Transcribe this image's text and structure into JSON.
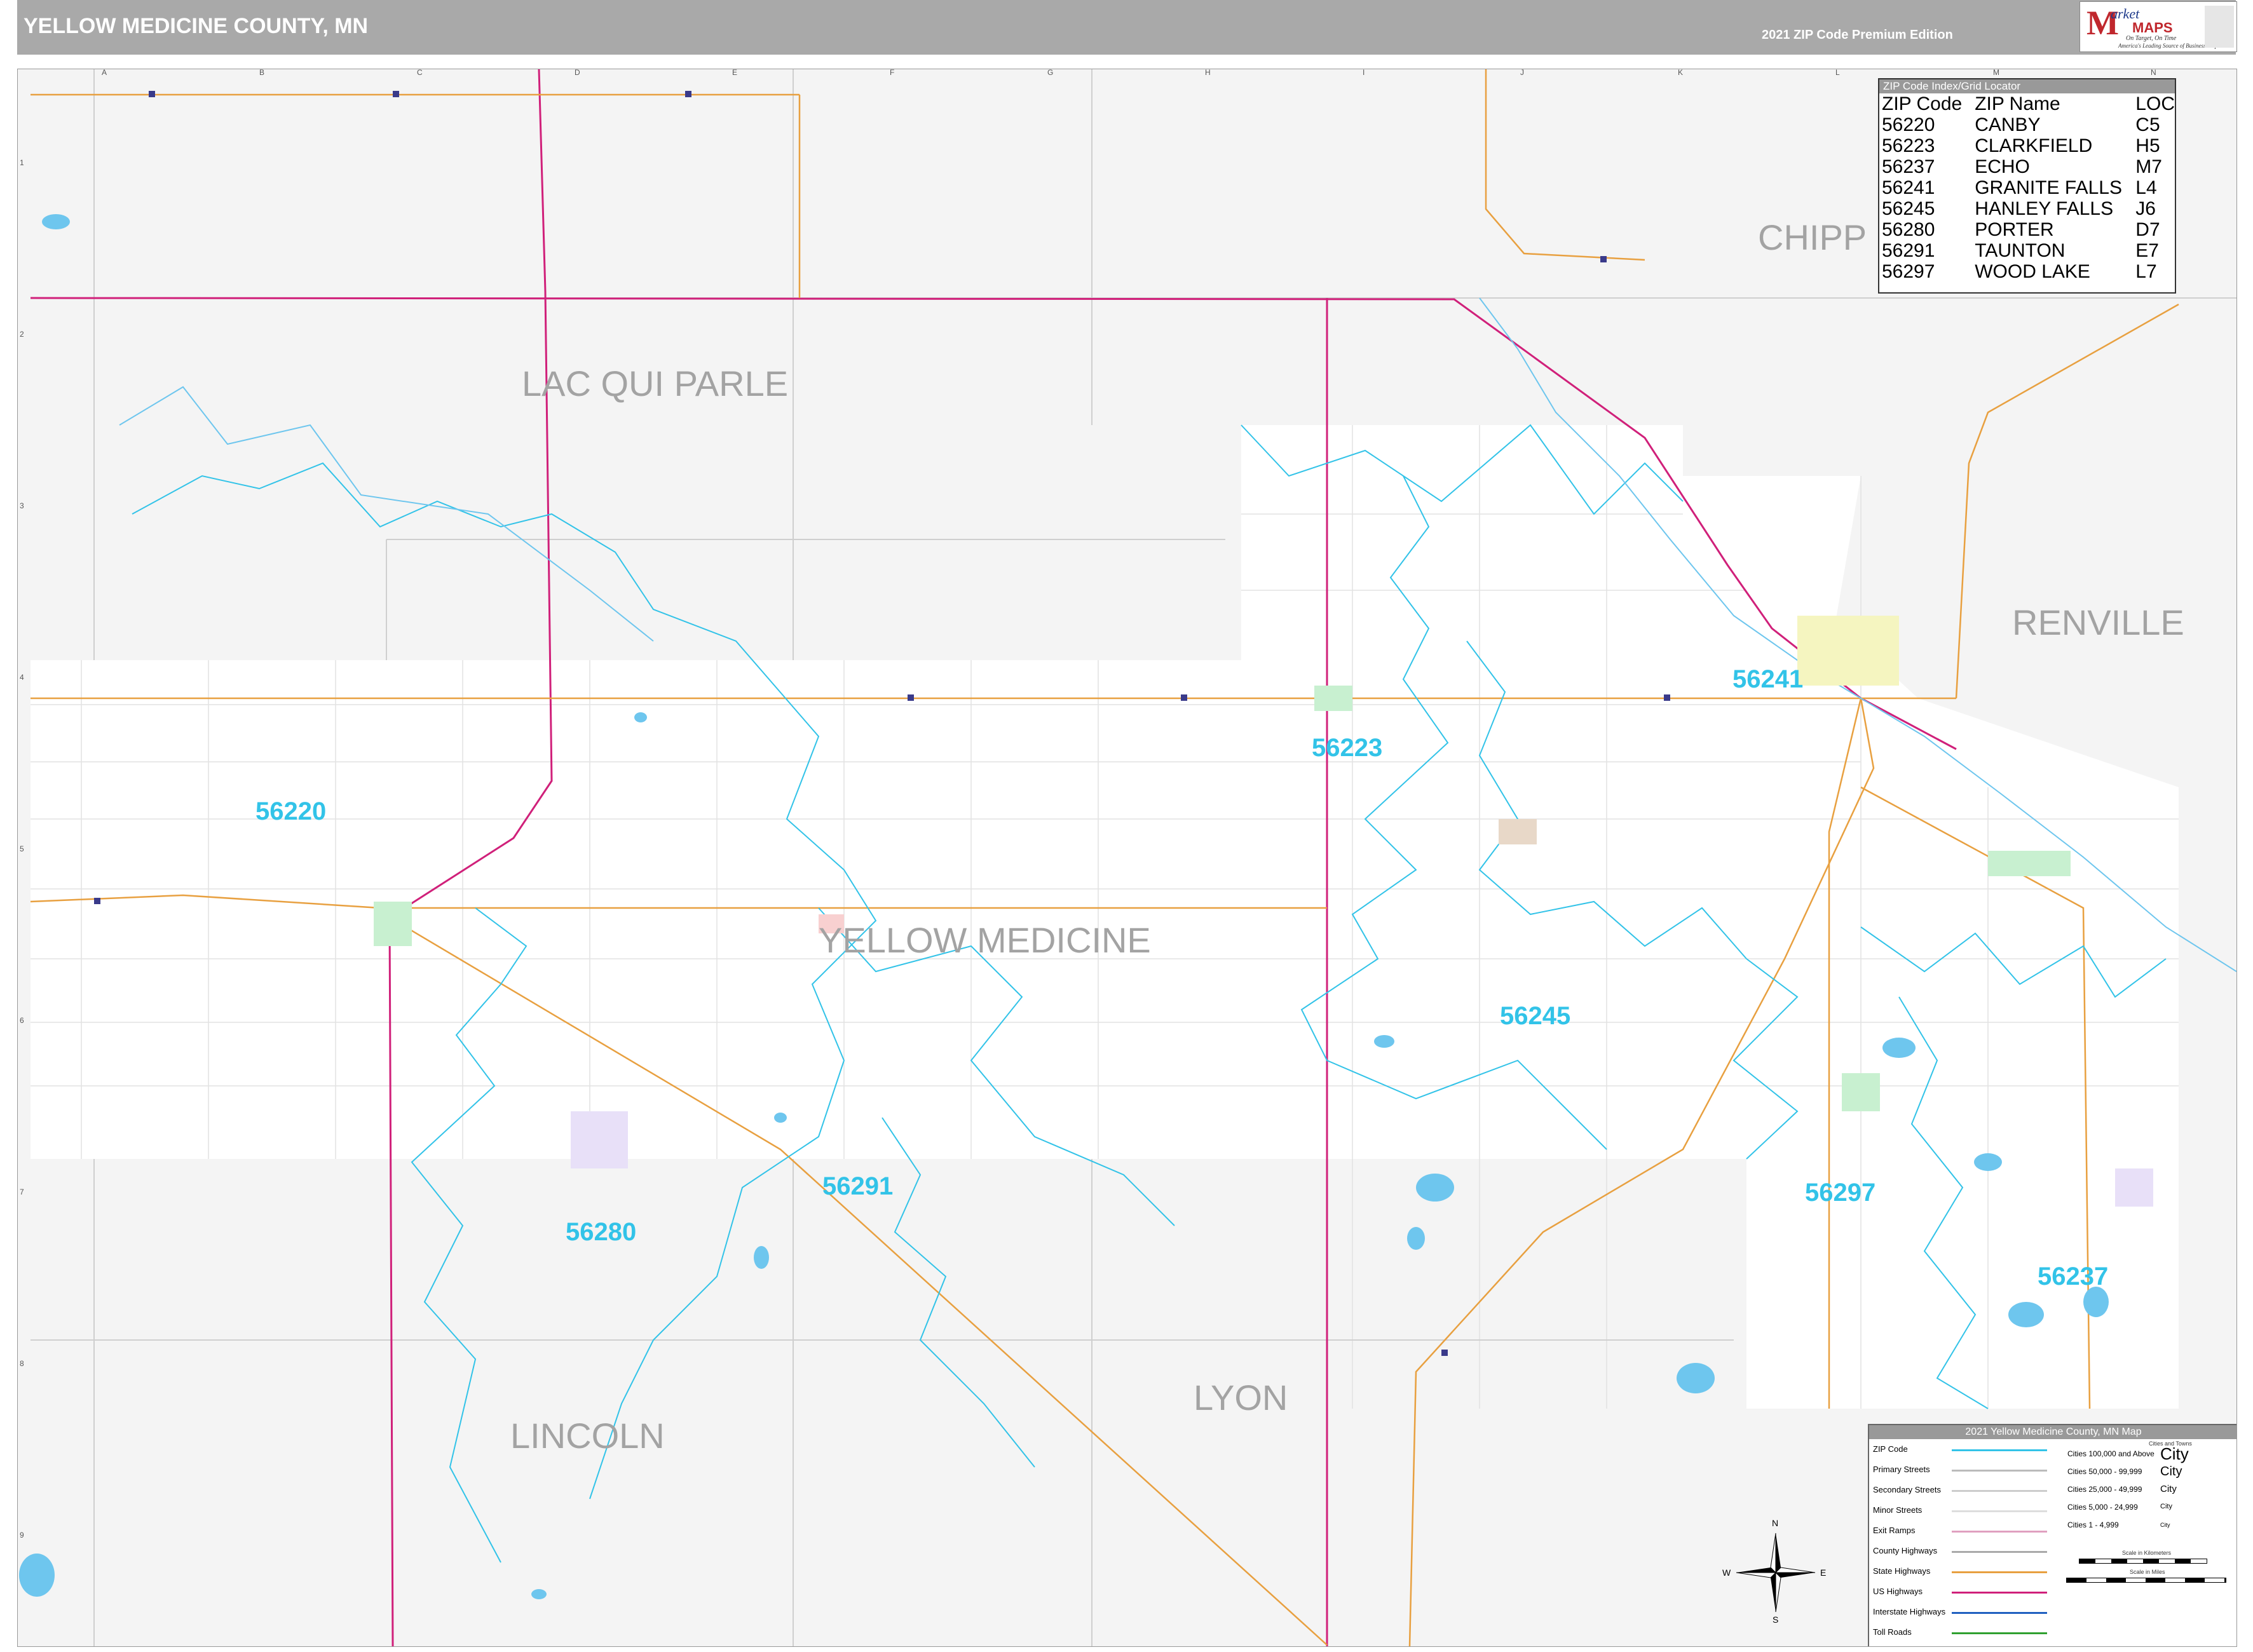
{
  "header": {
    "title": "YELLOW MEDICINE COUNTY, MN",
    "edition": "2021 ZIP Code Premium Edition",
    "background_color": "#a9a9a9"
  },
  "logo": {
    "m": "M",
    "arket": "arket",
    "maps": "MAPS",
    "tagline": "On Target, On Time",
    "tagline2": "America's Leading Source of Business Maps"
  },
  "grid": {
    "letters": [
      "A",
      "B",
      "C",
      "D",
      "E",
      "F",
      "G",
      "H",
      "I",
      "J",
      "K",
      "L",
      "M",
      "N"
    ],
    "numbers": [
      "1",
      "2",
      "3",
      "4",
      "5",
      "6",
      "7",
      "8",
      "9"
    ]
  },
  "counties": {
    "lac_qui_parle": "LAC QUI PARLE",
    "chippewa": "CHIPP",
    "renville": "RENVILLE",
    "yellow_medicine": "YELLOW MEDICINE",
    "lincoln": "LINCOLN",
    "lyon": "LYON"
  },
  "zip_labels": [
    "56220",
    "56223",
    "56241",
    "56245",
    "56291",
    "56280",
    "56297",
    "56237"
  ],
  "zip_index": {
    "title": "ZIP Code Index/Grid Locator",
    "columns": [
      "ZIP Code",
      "ZIP Name",
      "LOC"
    ],
    "rows": [
      [
        "56220",
        "CANBY",
        "C5"
      ],
      [
        "56223",
        "CLARKFIELD",
        "H5"
      ],
      [
        "56237",
        "ECHO",
        "M7"
      ],
      [
        "56241",
        "GRANITE FALLS",
        "L4"
      ],
      [
        "56245",
        "HANLEY FALLS",
        "J6"
      ],
      [
        "56280",
        "PORTER",
        "D7"
      ],
      [
        "56291",
        "TAUNTON",
        "E7"
      ],
      [
        "56297",
        "WOOD LAKE",
        "L7"
      ]
    ]
  },
  "legend": {
    "title": "2021 Yellow Medicine County, MN Map",
    "items": [
      {
        "label": "ZIP Code",
        "color": "#32c3e8"
      },
      {
        "label": "Primary Streets",
        "color": "#bbbbbb"
      },
      {
        "label": "Secondary Streets",
        "color": "#cccccc"
      },
      {
        "label": "Minor Streets",
        "color": "#dddddd"
      },
      {
        "label": "Exit Ramps",
        "color": "#e0a0c0"
      },
      {
        "label": "County Highways",
        "color": "#aaaaaa"
      },
      {
        "label": "State Highways",
        "color": "#e8a040"
      },
      {
        "label": "US Highways",
        "color": "#d0207a"
      },
      {
        "label": "Interstate Highways",
        "color": "#2060c0"
      },
      {
        "label": "Toll Roads",
        "color": "#30a030"
      }
    ],
    "cities_header": "Cities and Towns",
    "cities": [
      {
        "label": "Cities 100,000 and Above",
        "sample": "City"
      },
      {
        "label": "Cities 50,000 - 99,999",
        "sample": "City"
      },
      {
        "label": "Cities 25,000 - 49,999",
        "sample": "City"
      },
      {
        "label": "Cities 5,000 - 24,999",
        "sample": "City"
      },
      {
        "label": "Cities 1 - 4,999",
        "sample": "City"
      }
    ],
    "scale_km": "Scale in Kilometers",
    "scale_mi": "Scale in Miles"
  },
  "compass": {
    "n": "N",
    "s": "S",
    "e": "E",
    "w": "W"
  },
  "colors": {
    "zip_boundary": "#32c3e8",
    "us_highway": "#d0207a",
    "state_highway": "#e8a040",
    "outside_county": "#f4f4f4",
    "county_fill": "#ffffff",
    "water": "#6ec6ee",
    "city_fill": "#c8f0d0"
  }
}
